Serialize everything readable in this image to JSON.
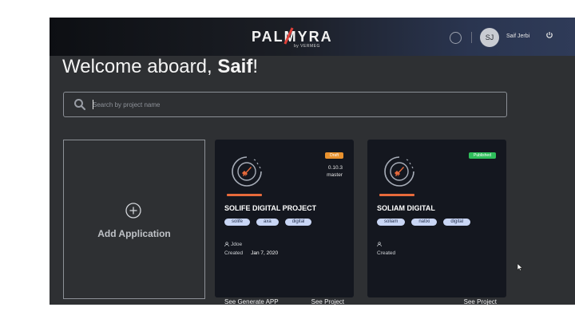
{
  "header": {
    "logo_text": "PALMYRA",
    "logo_sub": "by VERMEG",
    "avatar_initials": "SJ",
    "user_name": "Saif Jerbi"
  },
  "welcome": {
    "prefix": "Welcome aboard, ",
    "name": "Saif",
    "suffix": "!"
  },
  "search": {
    "placeholder": "Search by project name",
    "value": ""
  },
  "add_card": {
    "label": "Add Application"
  },
  "projects": [
    {
      "status": "Draft",
      "status_color": "#e9922e",
      "version": "0.10.3",
      "branch": "master",
      "title": "SOLIFE DIGITAL PROJECT",
      "tags": [
        "solife",
        "axa",
        "digital"
      ],
      "owner": "Jdoe",
      "created_label": "Created",
      "created_date": "Jan 7, 2020",
      "action_primary": "See Generate APP",
      "action_secondary": "See Project"
    },
    {
      "status": "Published",
      "status_color": "#2fbf5b",
      "title": "SOLIAM DIGITAL",
      "tags": [
        "soliam",
        "natixi",
        "digital"
      ],
      "owner": "",
      "created_label": "Created",
      "action_secondary": "See Project"
    }
  ],
  "colors": {
    "accent": "#e86a3b",
    "tag_bg": "#c9d6f5",
    "card_bg": "#14171f",
    "page_bg": "#2e3033"
  }
}
